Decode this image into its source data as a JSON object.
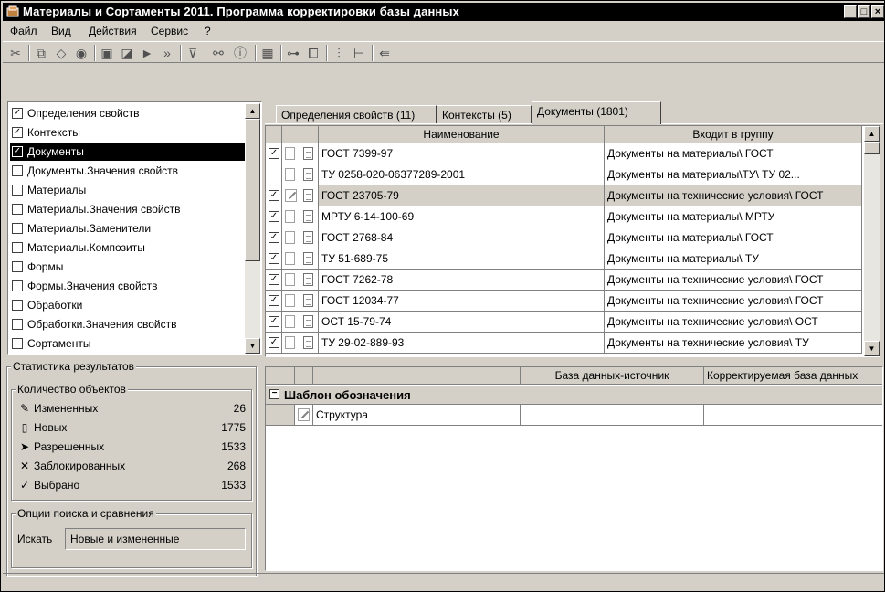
{
  "window": {
    "title": "Материалы и Сортаменты 2011. Программа корректировки базы данных",
    "controls": [
      "_",
      "□",
      "×"
    ]
  },
  "menu": [
    "Файл",
    "Вид",
    "Действия",
    "Сервис",
    "?"
  ],
  "toolbar_icons": [
    "tools-icon",
    "copy-db-icon",
    "eraser-icon",
    "stop-icon",
    "accept-icon",
    "reject-icon",
    "next-icon",
    "fast-forward-icon",
    "filter-icon",
    "binoculars-icon",
    "info-icon",
    "grid-icon",
    "diff-icon",
    "copy-icon",
    "columns-icon",
    "tree-icon",
    "exit-icon"
  ],
  "left_list": {
    "items": [
      {
        "label": "Определения свойств",
        "checked": true,
        "selected": false
      },
      {
        "label": "Контексты",
        "checked": true,
        "selected": false
      },
      {
        "label": "Документы",
        "checked": true,
        "selected": true
      },
      {
        "label": "Документы.Значения свойств",
        "checked": false,
        "selected": false
      },
      {
        "label": "Материалы",
        "checked": false,
        "selected": false
      },
      {
        "label": "Материалы.Значения свойств",
        "checked": false,
        "selected": false
      },
      {
        "label": "Материалы.Заменители",
        "checked": false,
        "selected": false
      },
      {
        "label": "Материалы.Композиты",
        "checked": false,
        "selected": false
      },
      {
        "label": "Формы",
        "checked": false,
        "selected": false
      },
      {
        "label": "Формы.Значения свойств",
        "checked": false,
        "selected": false
      },
      {
        "label": "Обработки",
        "checked": false,
        "selected": false
      },
      {
        "label": "Обработки.Значения свойств",
        "checked": false,
        "selected": false
      },
      {
        "label": "Сортаменты",
        "checked": false,
        "selected": false
      }
    ]
  },
  "stats": {
    "title": "Статистика результатов",
    "objects_title": "Количество объектов",
    "rows": [
      {
        "icon": "edit-icon",
        "label": "Измененных",
        "value": "26"
      },
      {
        "icon": "page-icon",
        "label": "Новых",
        "value": "1775"
      },
      {
        "icon": "arrow-icon",
        "label": "Разрешенных",
        "value": "1533"
      },
      {
        "icon": "cross-icon",
        "label": "Заблокированных",
        "value": "268"
      },
      {
        "icon": "check-icon",
        "label": "Выбрано",
        "value": "1533"
      }
    ]
  },
  "search": {
    "title": "Опции поиска и сравнения",
    "label": "Искать",
    "value": "Новые и измененные"
  },
  "tabs": [
    "Определения свойств (11)",
    "Контексты (5)",
    "Документы (1801)"
  ],
  "docs_grid": {
    "headers": [
      "Наименование",
      "Входит в группу"
    ],
    "rows": [
      {
        "checked": true,
        "icon": "page",
        "name": "ГОСТ 7399-97",
        "group": "Документы на материалы\\ ГОСТ"
      },
      {
        "checked": false,
        "icon": "page",
        "name": "ТУ 0258-020-06377289-2001",
        "group": "Документы на материалы\\ТУ\\ ТУ 02..."
      },
      {
        "checked": true,
        "icon": "edit",
        "name": "ГОСТ 23705-79",
        "group": "Документы на технические условия\\ ГОСТ",
        "selected": true
      },
      {
        "checked": true,
        "icon": "page",
        "name": "МРТУ 6-14-100-69",
        "group": "Документы на материалы\\ МРТУ"
      },
      {
        "checked": true,
        "icon": "page",
        "name": "ГОСТ 2768-84",
        "group": "Документы на материалы\\ ГОСТ"
      },
      {
        "checked": true,
        "icon": "page",
        "name": "ТУ 51-689-75",
        "group": "Документы на материалы\\ ТУ"
      },
      {
        "checked": true,
        "icon": "page",
        "name": "ГОСТ 7262-78",
        "group": "Документы на технические условия\\ ГОСТ"
      },
      {
        "checked": true,
        "icon": "page",
        "name": "ГОСТ 12034-77",
        "group": "Документы на технические условия\\ ГОСТ"
      },
      {
        "checked": true,
        "icon": "page",
        "name": "ОСТ 15-79-74",
        "group": "Документы на технические условия\\ ОСТ"
      },
      {
        "checked": true,
        "icon": "page",
        "name": "ТУ 29-02-889-93",
        "group": "Документы на технические условия\\ ТУ"
      }
    ]
  },
  "compare_grid": {
    "headers": [
      "База данных-источник",
      "Корректируемая база данных"
    ],
    "group_label": "Шаблон обозначения",
    "rows": [
      {
        "icon": "edit",
        "name": "Структура",
        "source": "",
        "target": ""
      }
    ]
  },
  "colors": {
    "face": "#d4d0c8",
    "title_bg": "#000000",
    "selection_bg": "#000000",
    "selected_row": "#d4d0c8"
  }
}
